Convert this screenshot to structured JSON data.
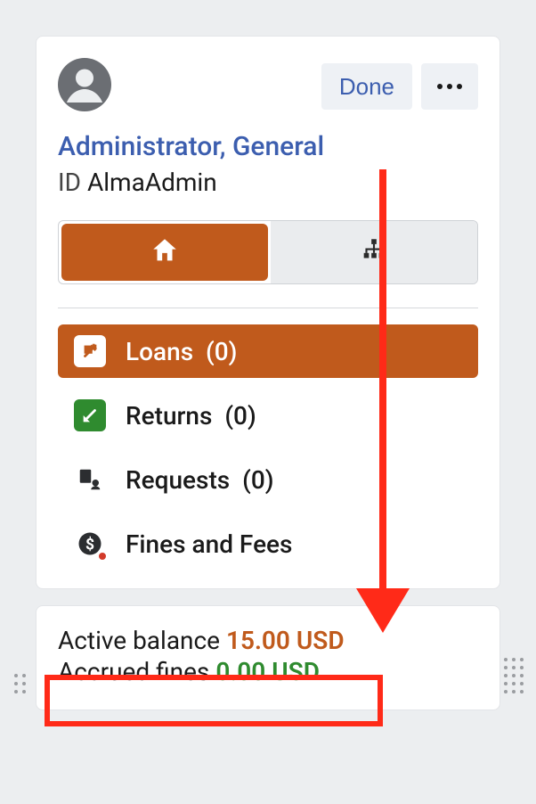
{
  "header": {
    "done_label": "Done"
  },
  "user": {
    "name": "Administrator, General",
    "id_label": "ID",
    "id_value": "AlmaAdmin"
  },
  "nav": {
    "loans": {
      "label": "Loans",
      "count": 0
    },
    "returns": {
      "label": "Returns",
      "count": 0
    },
    "requests": {
      "label": "Requests",
      "count": 0
    },
    "fines": {
      "label": "Fines and Fees"
    }
  },
  "balance": {
    "active_label": "Active balance",
    "active_amount": "15.00 USD",
    "accrued_label": "Accrued fines",
    "accrued_amount": "0.00 USD"
  }
}
